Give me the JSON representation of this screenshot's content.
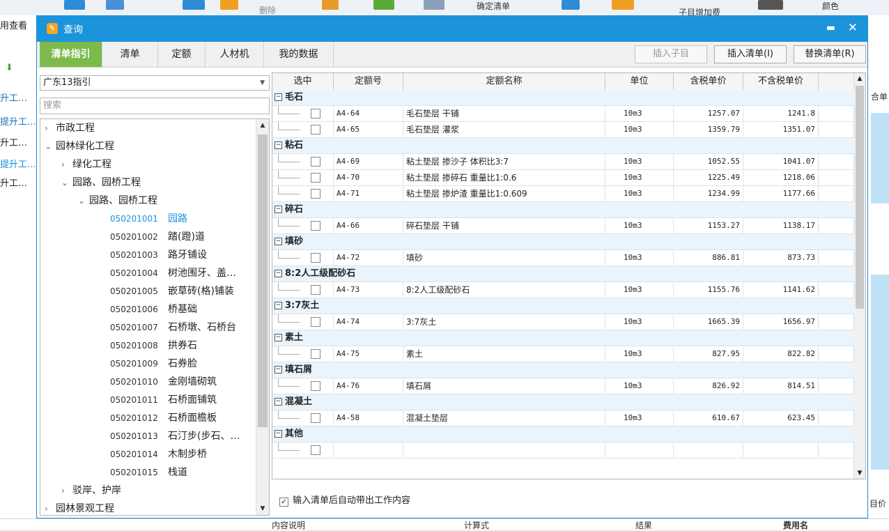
{
  "background": {
    "toolbar_delete": "删除",
    "toolbar_confirm": "确定清单",
    "toolbar_extra": "子目增加费",
    "toolbar_top_right": "颜色",
    "left_items": [
      "用查看",
      "升工…",
      "提升工…",
      "升工…",
      "提升工…",
      "升工…"
    ],
    "right_items": [
      "合单",
      "目价"
    ],
    "bottom_headers": [
      "内容说明",
      "计算式",
      "结果",
      "费用名"
    ]
  },
  "dialog": {
    "title": "查询",
    "tabs": [
      "清单指引",
      "清单",
      "定额",
      "人材机",
      "我的数据"
    ],
    "buttons": {
      "insert_child": "插入子目",
      "insert_list": "插入清单(I)",
      "replace_list": "替换清单(R)"
    },
    "region_select": "广东13指引",
    "search_placeholder": "搜索",
    "auto_option": "输入清单后自动带出工作内容"
  },
  "tree": [
    {
      "toggle": "›",
      "label": "市政工程",
      "level": 0
    },
    {
      "toggle": "⌄",
      "label": "园林绿化工程",
      "level": 0
    },
    {
      "toggle": "›",
      "label": "绿化工程",
      "level": 1
    },
    {
      "toggle": "⌄",
      "label": "园路、园桥工程",
      "level": 1
    },
    {
      "toggle": "⌄",
      "label": "园路、园桥工程",
      "level": 2
    },
    {
      "code": "050201001",
      "label": "园路",
      "selected": true
    },
    {
      "code": "050201002",
      "label": "踏(蹬)道"
    },
    {
      "code": "050201003",
      "label": "路牙铺设"
    },
    {
      "code": "050201004",
      "label": "树池围牙、盖…"
    },
    {
      "code": "050201005",
      "label": "嵌草砖(格)铺装"
    },
    {
      "code": "050201006",
      "label": "桥基础"
    },
    {
      "code": "050201007",
      "label": "石桥墩、石桥台"
    },
    {
      "code": "050201008",
      "label": "拱券石"
    },
    {
      "code": "050201009",
      "label": "石券脸"
    },
    {
      "code": "050201010",
      "label": "金刚墙砌筑"
    },
    {
      "code": "050201011",
      "label": "石桥面铺筑"
    },
    {
      "code": "050201012",
      "label": "石桥面檐板"
    },
    {
      "code": "050201013",
      "label": "石汀步(步石、…"
    },
    {
      "code": "050201014",
      "label": "木制步桥"
    },
    {
      "code": "050201015",
      "label": "栈道"
    },
    {
      "toggle": "›",
      "label": "驳岸、护岸",
      "level": 1
    },
    {
      "toggle": "›",
      "label": "园林景观工程",
      "level": 0
    }
  ],
  "grid": {
    "headers": [
      "选中",
      "定额号",
      "定额名称",
      "单位",
      "含税单价",
      "不含税单价"
    ],
    "groups": [
      {
        "title": "毛石",
        "rows": [
          {
            "code": "A4-64",
            "name": "毛石垫层 干铺",
            "unit": "10m3",
            "tax": "1257.07",
            "notax": "1241.8"
          },
          {
            "code": "A4-65",
            "name": "毛石垫层 灌浆",
            "unit": "10m3",
            "tax": "1359.79",
            "notax": "1351.07"
          }
        ]
      },
      {
        "title": "粘石",
        "rows": [
          {
            "code": "A4-69",
            "name": "粘土垫层 掺沙子 体积比3:7",
            "unit": "10m3",
            "tax": "1052.55",
            "notax": "1041.07"
          },
          {
            "code": "A4-70",
            "name": "粘土垫层 掺碎石 重量比1:0.6",
            "unit": "10m3",
            "tax": "1225.49",
            "notax": "1218.06"
          },
          {
            "code": "A4-71",
            "name": "粘土垫层 掺炉渣 重量比1:0.609",
            "unit": "10m3",
            "tax": "1234.99",
            "notax": "1177.66"
          }
        ]
      },
      {
        "title": "碎石",
        "rows": [
          {
            "code": "A4-66",
            "name": "碎石垫层 干铺",
            "unit": "10m3",
            "tax": "1153.27",
            "notax": "1138.17"
          }
        ]
      },
      {
        "title": "填砂",
        "rows": [
          {
            "code": "A4-72",
            "name": "填砂",
            "unit": "10m3",
            "tax": "886.81",
            "notax": "873.73"
          }
        ]
      },
      {
        "title": "8:2人工级配砂石",
        "rows": [
          {
            "code": "A4-73",
            "name": "8:2人工级配砂石",
            "unit": "10m3",
            "tax": "1155.76",
            "notax": "1141.62"
          }
        ]
      },
      {
        "title": "3:7灰土",
        "rows": [
          {
            "code": "A4-74",
            "name": "3:7灰土",
            "unit": "10m3",
            "tax": "1665.39",
            "notax": "1656.97"
          }
        ]
      },
      {
        "title": "素土",
        "rows": [
          {
            "code": "A4-75",
            "name": "素土",
            "unit": "10m3",
            "tax": "827.95",
            "notax": "822.82"
          }
        ]
      },
      {
        "title": "填石屑",
        "rows": [
          {
            "code": "A4-76",
            "name": "填石屑",
            "unit": "10m3",
            "tax": "826.92",
            "notax": "814.51"
          }
        ]
      },
      {
        "title": "混凝土",
        "rows": [
          {
            "code": "A4-58",
            "name": "混凝土垫层",
            "unit": "10m3",
            "tax": "610.67",
            "notax": "623.45"
          }
        ]
      },
      {
        "title": "其他",
        "rows": [
          {
            "code": "",
            "name": "",
            "unit": "",
            "tax": "",
            "notax": ""
          }
        ]
      }
    ]
  },
  "colors": {
    "titlebar": "#1b94dc",
    "active_tab": "#7cbb4b",
    "selected_link": "#1a8fe0",
    "group_row": "#eaf4fc"
  }
}
